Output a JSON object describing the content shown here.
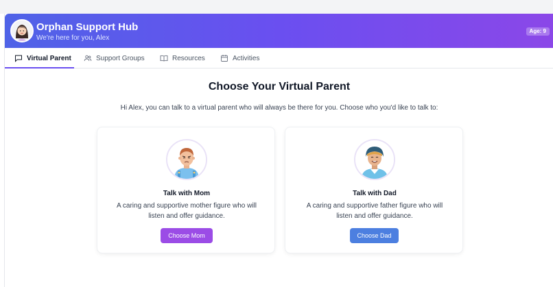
{
  "header": {
    "title": "Orphan Support Hub",
    "subtitle": "We're here for you, Alex",
    "age_badge": "Age: 9"
  },
  "tabs": [
    {
      "label": "Virtual Parent",
      "icon": "message-square-icon",
      "active": true
    },
    {
      "label": "Support Groups",
      "icon": "users-icon",
      "active": false
    },
    {
      "label": "Resources",
      "icon": "book-open-icon",
      "active": false
    },
    {
      "label": "Activities",
      "icon": "calendar-icon",
      "active": false
    }
  ],
  "main": {
    "title": "Choose Your Virtual Parent",
    "intro": "Hi Alex, you can talk to a virtual parent who will always be there for you. Choose who you'd like to talk to:"
  },
  "cards": [
    {
      "title": "Talk with Mom",
      "description": "A caring and supportive mother figure who will listen and offer guidance.",
      "button": "Choose Mom",
      "button_color": "#9b4ce6"
    },
    {
      "title": "Talk with Dad",
      "description": "A caring and supportive father figure who will listen and offer guidance.",
      "button": "Choose Dad",
      "button_color": "#4c7fe0"
    }
  ],
  "colors": {
    "header_gradient_start": "#4f63e7",
    "header_gradient_end": "#8b47e8",
    "active_tab_accent": "#6a4ff0"
  }
}
